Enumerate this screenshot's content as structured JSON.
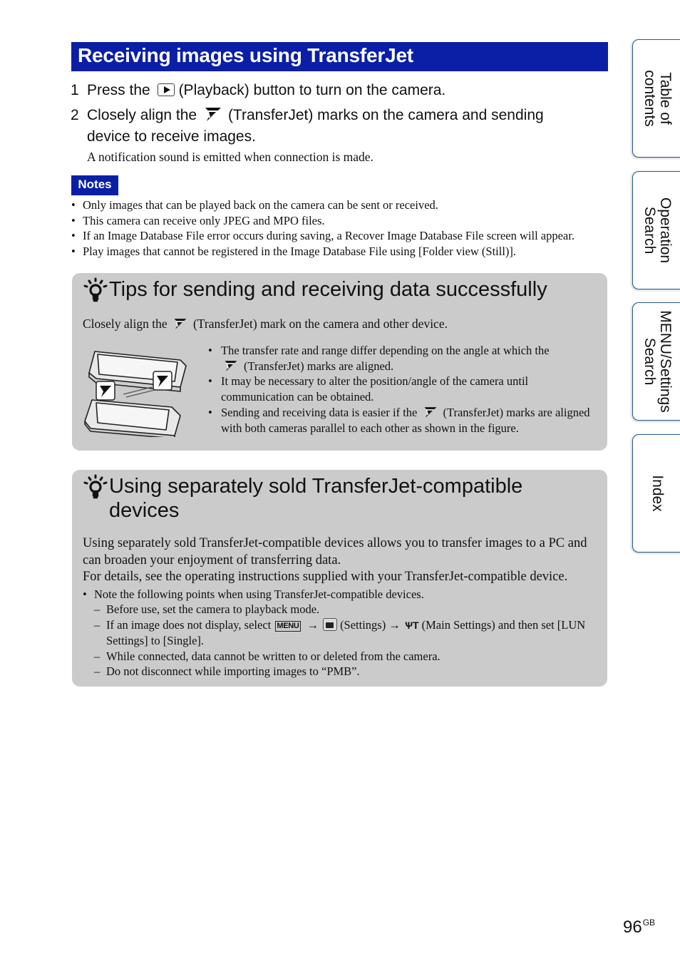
{
  "page": {
    "title": "Receiving images using TransferJet",
    "page_number": "96",
    "page_suffix": "GB"
  },
  "steps": [
    {
      "num": "1",
      "before": "Press the",
      "icon": "playback-button-icon",
      "after": "(Playback) button to turn on the camera."
    },
    {
      "num": "2",
      "before": "Closely align the",
      "icon": "transferjet-icon",
      "after": "(TransferJet) marks on the camera and sending",
      "line2": "device to receive images.",
      "note": "A notification sound is emitted when connection is made."
    }
  ],
  "notes": {
    "label": "Notes",
    "items": [
      "Only images that can be played back on the camera can be sent or received.",
      "This camera can receive only JPEG and MPO files.",
      "If an Image Database File error occurs during saving, a Recover Image Database File screen will appear.",
      "Play images that cannot be registered in the Image Database File using [Folder view (Still)]."
    ]
  },
  "tips_panel": {
    "icon": "hint-bulb-icon",
    "heading": "Tips for sending and receiving data successfully",
    "lead_before": "Closely align the",
    "lead_after": "(TransferJet) mark on the camera and other device.",
    "figure": "two-cameras-aligned-illustration",
    "items": [
      {
        "before": "The transfer rate and range differ depending on the angle at which the",
        "icon": "transferjet-icon",
        "after": "(TransferJet) marks are aligned."
      },
      {
        "text": "It may be necessary to alter the position/angle of the camera until communication can be obtained."
      },
      {
        "before": "Sending and receiving data is easier if the",
        "icon": "transferjet-icon",
        "after": "(TransferJet) marks are aligned with both cameras parallel to each other as shown in the figure."
      }
    ]
  },
  "devices_panel": {
    "icon": "hint-bulb-icon",
    "heading": "Using separately sold TransferJet-compatible devices",
    "paragraphs": [
      "Using separately sold TransferJet-compatible devices allows you to transfer images to a PC and can broaden your enjoyment of transferring data.",
      "For details, see the operating instructions supplied with your TransferJet-compatible device."
    ],
    "bullet": "Note the following points when using TransferJet-compatible devices.",
    "sub_items": [
      {
        "text": "Before use, set the camera to playback mode."
      },
      {
        "before": "If an image does not display, select",
        "menu_label": "MENU",
        "arrow": "→",
        "settings_label": "(Settings)",
        "main_settings_glyph": "ѰT",
        "after": "(Main Settings) and then set [LUN Settings] to [Single]."
      },
      {
        "text": "While connected, data cannot be written to or deleted from the camera."
      },
      {
        "text": "Do not disconnect while importing images to “PMB”."
      }
    ]
  },
  "side_tabs": [
    {
      "line1": "Table of",
      "line2": "contents"
    },
    {
      "line1": "Operation",
      "line2": "Search"
    },
    {
      "line1": "MENU/Settings",
      "line2": "Search"
    },
    {
      "line1": "Index",
      "line2": ""
    }
  ],
  "colors": {
    "heading_blue": "#0a1fa6",
    "panel_gray": "#cbcbcb",
    "tab_border": "#2a5b93"
  }
}
